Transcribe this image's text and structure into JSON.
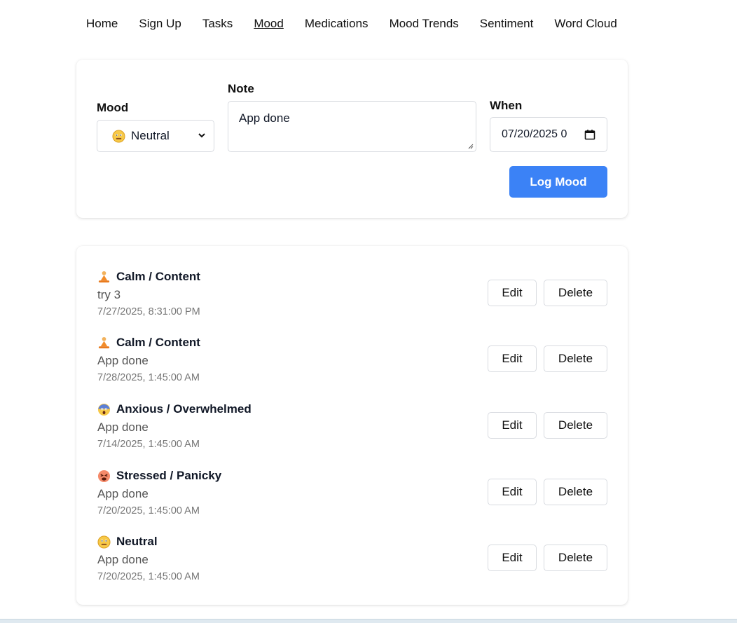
{
  "nav": {
    "items": [
      "Home",
      "Sign Up",
      "Tasks",
      "Mood",
      "Medications",
      "Mood Trends",
      "Sentiment",
      "Word Cloud"
    ],
    "active": "Mood"
  },
  "form": {
    "mood_label": "Mood",
    "mood_value": "Neutral",
    "mood_icon": "neutral-face-icon",
    "note_label": "Note",
    "note_value": "App done",
    "when_label": "When",
    "when_value": "07/20/2025  0",
    "submit_label": "Log Mood",
    "accent_color": "#3b82f6"
  },
  "entries": [
    {
      "icon": "meditation-icon",
      "mood": "Calm / Content",
      "note": "try 3",
      "time": "7/27/2025, 8:31:00 PM"
    },
    {
      "icon": "meditation-icon",
      "mood": "Calm / Content",
      "note": "App done",
      "time": "7/28/2025, 1:45:00 AM"
    },
    {
      "icon": "scream-face-icon",
      "mood": "Anxious / Overwhelmed",
      "note": "App done",
      "time": "7/14/2025, 1:45:00 AM"
    },
    {
      "icon": "tired-face-icon",
      "mood": "Stressed / Panicky",
      "note": "App done",
      "time": "7/20/2025, 1:45:00 AM"
    },
    {
      "icon": "neutral-face-icon",
      "mood": "Neutral",
      "note": "App done",
      "time": "7/20/2025, 1:45:00 AM"
    }
  ],
  "actions": {
    "edit_label": "Edit",
    "delete_label": "Delete"
  }
}
